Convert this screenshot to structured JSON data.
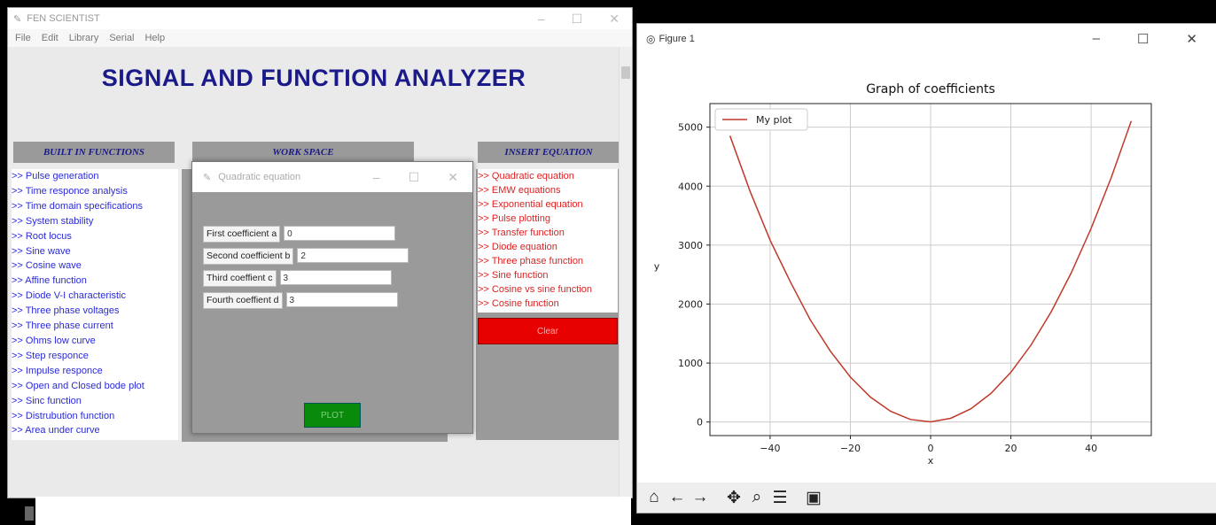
{
  "app": {
    "title": "FEN SCIENTIST",
    "menu": [
      "File",
      "Edit",
      "Library",
      "Serial",
      "Help"
    ],
    "heading": "SIGNAL AND FUNCTION ANALYZER",
    "sections": {
      "built_in": "BUILT IN FUNCTIONS",
      "workspace": "WORK SPACE",
      "insert": "INSERT EQUATION"
    },
    "builtin_items": [
      ">> Pulse generation",
      ">> Time responce analysis",
      ">> Time domain specifications",
      ">> System stability",
      ">> Root locus",
      ">> Sine wave",
      ">> Cosine wave",
      ">> Affine function",
      ">> Diode V-I characteristic",
      ">> Three phase voltages",
      ">> Three phase current",
      ">> Ohms low curve",
      ">> Step responce",
      ">> Impulse responce",
      ">> Open and Closed bode plot",
      ">> Sinc function",
      ">> Distrubution function",
      ">> Area under curve"
    ],
    "insert_items": [
      ">> Quadratic equation",
      ">> EMW equations",
      ">> Exponential equation",
      ">> Pulse plotting",
      ">> Transfer function",
      ">> Diode equation",
      ">> Three phase function",
      ">> Sine function",
      ">> Cosine vs sine function",
      ">> Cosine function"
    ],
    "clear_label": "Clear"
  },
  "dialog": {
    "title": "Quadratic equation",
    "fields": [
      {
        "label": "First coefficient  a",
        "value": "0"
      },
      {
        "label": "Second coefficient b",
        "value": "2"
      },
      {
        "label": "Third coeffient   c",
        "value": "3"
      },
      {
        "label": "Fourth coeffient   d",
        "value": "3"
      }
    ],
    "plot_label": "PLOT"
  },
  "figure": {
    "title": "Figure 1",
    "toolbar_icons": [
      "home-icon",
      "back-icon",
      "forward-icon",
      "pan-icon",
      "zoom-icon",
      "configure-icon",
      "save-icon"
    ]
  },
  "chart_data": {
    "type": "line",
    "title": "Graph of coefficients",
    "xlabel": "x",
    "ylabel": "y",
    "xlim": [
      -55,
      55
    ],
    "ylim": [
      -230,
      5400
    ],
    "xticks": [
      -40,
      -20,
      0,
      20,
      40
    ],
    "yticks": [
      0,
      1000,
      2000,
      3000,
      4000,
      5000
    ],
    "grid": true,
    "legend_position": "top-left",
    "series": [
      {
        "name": "My plot",
        "color": "#c0392b",
        "x": [
          -50,
          -45,
          -40,
          -35,
          -30,
          -25,
          -20,
          -15,
          -10,
          -5,
          0,
          5,
          10,
          15,
          20,
          25,
          30,
          35,
          40,
          45,
          50
        ],
        "y": [
          4853,
          3913,
          3083,
          2383,
          1733,
          1203,
          763,
          423,
          183,
          43,
          3,
          63,
          223,
          483,
          843,
          1303,
          1863,
          2523,
          3283,
          4143,
          5103
        ]
      }
    ]
  }
}
